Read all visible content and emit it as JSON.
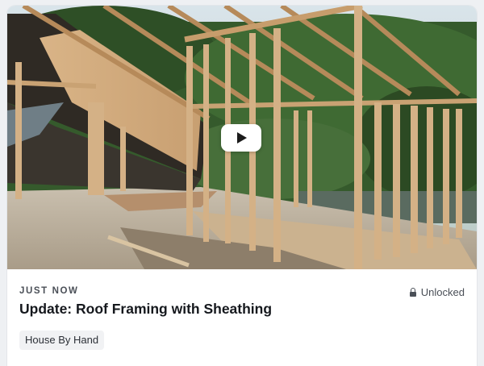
{
  "post": {
    "timestamp": "JUST NOW",
    "access_label": "Unlocked",
    "title": "Update: Roof Framing with Sheathing",
    "tag": "House By Hand"
  },
  "media": {
    "description_icon": "play-icon",
    "kind": "video-thumbnail"
  },
  "icons": {
    "play": "play-icon",
    "lock": "lock-icon"
  },
  "colors": {
    "card_background": "#ffffff",
    "page_background": "#eef0f3",
    "title_text": "#15181d",
    "meta_text": "#4a4f57",
    "tag_background": "#f1f2f4"
  }
}
